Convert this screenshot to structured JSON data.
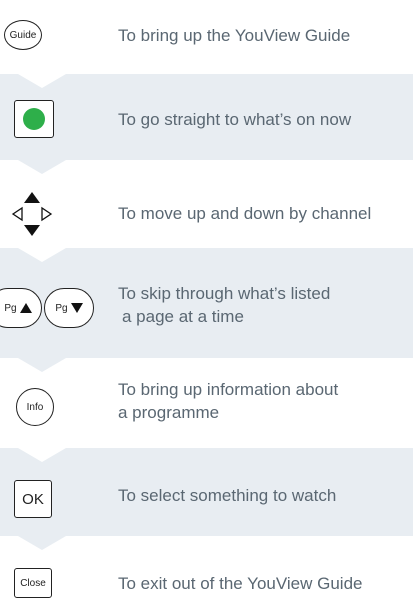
{
  "rows": [
    {
      "key": "Guide",
      "text": [
        "To bring up the YouView Guide"
      ]
    },
    {
      "key": "",
      "text": [
        "To go straight to what’s on now"
      ]
    },
    {
      "key": "",
      "text": [
        "To move up and down by channel"
      ]
    },
    {
      "key_up": "Pg",
      "key_down": "Pg",
      "text": [
        "To skip through what’s listed",
        "a page at a time"
      ]
    },
    {
      "key": "Info",
      "text": [
        "To bring up information about",
        "a programme"
      ]
    },
    {
      "key": "OK",
      "text": [
        "To select something to watch"
      ]
    },
    {
      "key": "Close",
      "text": [
        "To exit out of the YouView Guide"
      ]
    }
  ],
  "colors": {
    "band": "#e8edf2",
    "text": "#5a6772",
    "green_button": "#2eaf4a"
  }
}
